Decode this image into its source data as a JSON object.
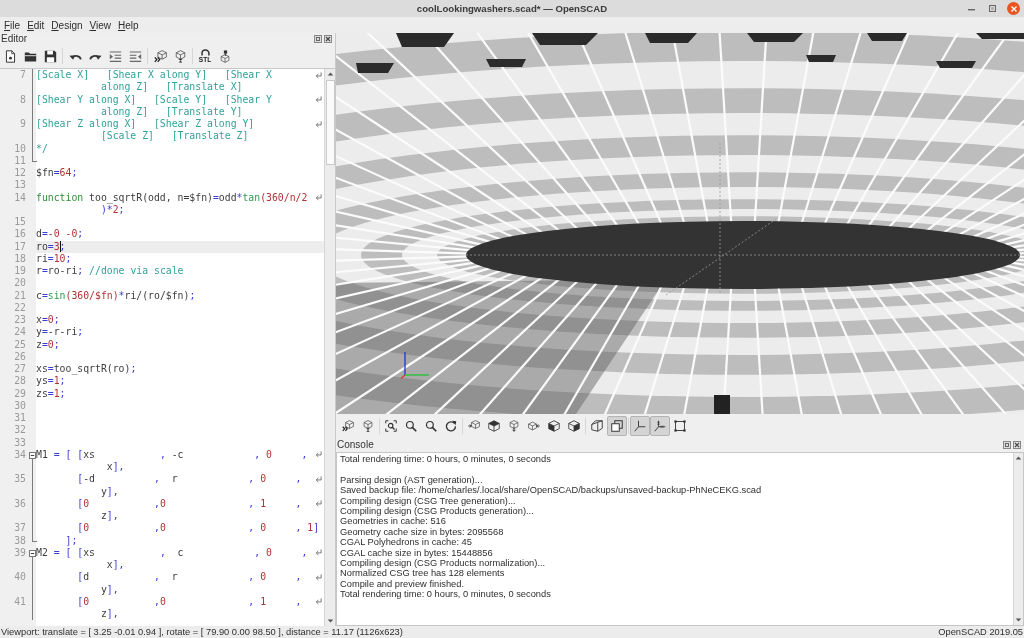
{
  "window": {
    "title": "coolLookingwashers.scad* — OpenSCAD"
  },
  "menu": [
    "File",
    "Edit",
    "Design",
    "View",
    "Help"
  ],
  "editor": {
    "title": "Editor",
    "toolbar": [
      [
        {
          "kind": "new"
        },
        {
          "kind": "open"
        },
        {
          "kind": "save"
        }
      ],
      [
        {
          "kind": "undo"
        },
        {
          "kind": "redo"
        },
        {
          "kind": "indent"
        },
        {
          "kind": "unindent"
        }
      ],
      [
        {
          "kind": "preview"
        },
        {
          "kind": "render"
        }
      ],
      [
        {
          "kind": "export-stl",
          "label": "STL"
        },
        {
          "kind": "print"
        }
      ]
    ],
    "lines": [
      {
        "number": "7",
        "current": false,
        "fold": {
          "kind": "body"
        },
        "visual_lines": [
          {
            "tokens": [
              {
                "kind": "comment",
                "text": "[Scale X]   [Shear X along Y]   [Shear X"
              }
            ]
          },
          {
            "tokens": [
              {
                "kind": "comment",
                "text": "along Z]   [Translate X]"
              }
            ]
          }
        ]
      },
      {
        "number": "8",
        "current": false,
        "fold": {
          "kind": "body"
        },
        "visual_lines": [
          {
            "tokens": [
              {
                "kind": "comment",
                "text": "[Shear Y along X]   [Scale Y]   [Shear Y"
              }
            ]
          },
          {
            "tokens": [
              {
                "kind": "comment",
                "text": "along Z]   [Translate Y]"
              }
            ]
          }
        ]
      },
      {
        "number": "9",
        "current": false,
        "fold": {
          "kind": "body"
        },
        "visual_lines": [
          {
            "tokens": [
              {
                "kind": "comment",
                "text": "[Shear Z along X]   [Shear Z along Y]"
              }
            ]
          },
          {
            "tokens": [
              {
                "kind": "comment",
                "text": "[Scale Z]   [Translate Z]"
              }
            ]
          }
        ]
      },
      {
        "number": "10",
        "current": false,
        "fold": {
          "kind": "body"
        },
        "visual_lines": [
          {
            "tokens": [
              {
                "kind": "comment",
                "text": "*/"
              }
            ]
          }
        ]
      },
      {
        "number": "11",
        "current": false,
        "fold": {
          "kind": "end"
        }
      },
      {
        "number": "12",
        "current": false,
        "visual_lines": [
          {
            "tokens": [
              {
                "kind": "plain",
                "text": "$fn"
              },
              {
                "kind": "op",
                "text": "="
              },
              {
                "kind": "number",
                "text": "64"
              },
              {
                "kind": "op",
                "text": ";"
              }
            ]
          }
        ]
      },
      {
        "number": "13",
        "current": false
      },
      {
        "number": "14",
        "current": false,
        "visual_lines": [
          {
            "tokens": [
              {
                "kind": "keyword",
                "text": "function"
              },
              {
                "kind": "plain",
                "text": " too_sqrtR(odd, n=$fn)"
              },
              {
                "kind": "op",
                "text": "="
              },
              {
                "kind": "plain",
                "text": "odd"
              },
              {
                "kind": "op",
                "text": "*"
              },
              {
                "kind": "builtin",
                "text": "tan"
              },
              {
                "kind": "number",
                "text": "(360/n/2"
              }
            ]
          },
          {
            "tokens": [
              {
                "kind": "op",
                "text": ")*"
              },
              {
                "kind": "number",
                "text": "2"
              },
              {
                "kind": "op",
                "text": ";"
              }
            ]
          }
        ]
      },
      {
        "number": "15",
        "current": false
      },
      {
        "number": "16",
        "current": false,
        "visual_lines": [
          {
            "tokens": [
              {
                "kind": "plain",
                "text": "d"
              },
              {
                "kind": "op",
                "text": "="
              },
              {
                "kind": "number",
                "text": "-0 -0"
              },
              {
                "kind": "op",
                "text": ";"
              }
            ]
          }
        ]
      },
      {
        "number": "17",
        "current": true,
        "visual_lines": [
          {
            "tokens": [
              {
                "kind": "plain",
                "text": "ro"
              },
              {
                "kind": "op",
                "text": "="
              },
              {
                "kind": "number",
                "text": "3"
              },
              {
                "kind": "cursor"
              },
              {
                "kind": "op",
                "text": ";"
              }
            ]
          }
        ]
      },
      {
        "number": "18",
        "current": false,
        "visual_lines": [
          {
            "tokens": [
              {
                "kind": "plain",
                "text": "ri"
              },
              {
                "kind": "op",
                "text": "="
              },
              {
                "kind": "number",
                "text": "10"
              },
              {
                "kind": "op",
                "text": ";"
              }
            ]
          }
        ]
      },
      {
        "number": "19",
        "current": false,
        "visual_lines": [
          {
            "tokens": [
              {
                "kind": "plain",
                "text": "r"
              },
              {
                "kind": "op",
                "text": "="
              },
              {
                "kind": "plain",
                "text": "ro-ri"
              },
              {
                "kind": "op",
                "text": ";"
              },
              {
                "kind": "comment",
                "text": " //done via scale"
              }
            ]
          }
        ]
      },
      {
        "number": "20",
        "current": false
      },
      {
        "number": "21",
        "current": false,
        "visual_lines": [
          {
            "tokens": [
              {
                "kind": "plain",
                "text": "c"
              },
              {
                "kind": "op",
                "text": "="
              },
              {
                "kind": "builtin",
                "text": "sin"
              },
              {
                "kind": "number",
                "text": "(360/$fn)"
              },
              {
                "kind": "op",
                "text": "*"
              },
              {
                "kind": "plain",
                "text": "ri/(ro/$fn)"
              },
              {
                "kind": "op",
                "text": ";"
              }
            ]
          }
        ]
      },
      {
        "number": "22",
        "current": false
      },
      {
        "number": "23",
        "current": false,
        "visual_lines": [
          {
            "tokens": [
              {
                "kind": "plain",
                "text": "x"
              },
              {
                "kind": "op",
                "text": "="
              },
              {
                "kind": "number",
                "text": "0"
              },
              {
                "kind": "op",
                "text": ";"
              }
            ]
          }
        ]
      },
      {
        "number": "24",
        "current": false,
        "visual_lines": [
          {
            "tokens": [
              {
                "kind": "plain",
                "text": "y"
              },
              {
                "kind": "op",
                "text": "="
              },
              {
                "kind": "plain",
                "text": "-r-ri"
              },
              {
                "kind": "op",
                "text": ";"
              }
            ]
          }
        ]
      },
      {
        "number": "25",
        "current": false,
        "visual_lines": [
          {
            "tokens": [
              {
                "kind": "plain",
                "text": "z"
              },
              {
                "kind": "op",
                "text": "="
              },
              {
                "kind": "number",
                "text": "0"
              },
              {
                "kind": "op",
                "text": ";"
              }
            ]
          }
        ]
      },
      {
        "number": "26",
        "current": false
      },
      {
        "number": "27",
        "current": false,
        "visual_lines": [
          {
            "tokens": [
              {
                "kind": "plain",
                "text": "xs"
              },
              {
                "kind": "op",
                "text": "="
              },
              {
                "kind": "plain",
                "text": "too_sqrtR(ro)"
              },
              {
                "kind": "op",
                "text": ";"
              }
            ]
          }
        ]
      },
      {
        "number": "28",
        "current": false,
        "visual_lines": [
          {
            "tokens": [
              {
                "kind": "plain",
                "text": "ys"
              },
              {
                "kind": "op",
                "text": "="
              },
              {
                "kind": "number",
                "text": "1"
              },
              {
                "kind": "op",
                "text": ";"
              }
            ]
          }
        ]
      },
      {
        "number": "29",
        "current": false,
        "visual_lines": [
          {
            "tokens": [
              {
                "kind": "plain",
                "text": "zs"
              },
              {
                "kind": "op",
                "text": "="
              },
              {
                "kind": "number",
                "text": "1"
              },
              {
                "kind": "op",
                "text": ";"
              }
            ]
          }
        ]
      },
      {
        "number": "30",
        "current": false
      },
      {
        "number": "31",
        "current": false
      },
      {
        "number": "32",
        "current": false
      },
      {
        "number": "33",
        "current": false
      },
      {
        "number": "34",
        "current": false,
        "fold": {
          "kind": "start"
        },
        "visual_lines": [
          {
            "tokens": [
              {
                "kind": "plain",
                "text": "M1"
              },
              {
                "kind": "op",
                "text": " = [ ["
              },
              {
                "kind": "plain",
                "text": "xs           "
              },
              {
                "kind": "op",
                "text": ","
              },
              {
                "kind": "plain",
                "text": " -c            "
              },
              {
                "kind": "op",
                "text": ","
              },
              {
                "kind": "number",
                "text": " 0     "
              },
              {
                "kind": "op",
                "text": ","
              }
            ]
          },
          {
            "tokens": [
              {
                "kind": "plain",
                "text": " x"
              },
              {
                "kind": "op",
                "text": "],"
              }
            ]
          }
        ]
      },
      {
        "number": "35",
        "current": false,
        "fold": {
          "kind": "body"
        },
        "visual_lines": [
          {
            "tokens": [
              {
                "kind": "op",
                "text": "       ["
              },
              {
                "kind": "plain",
                "text": "-d          "
              },
              {
                "kind": "op",
                "text": ","
              },
              {
                "kind": "plain",
                "text": "  r            "
              },
              {
                "kind": "op",
                "text": ","
              },
              {
                "kind": "number",
                "text": " 0     "
              },
              {
                "kind": "op",
                "text": ","
              }
            ]
          },
          {
            "tokens": [
              {
                "kind": "plain",
                "text": "y"
              },
              {
                "kind": "op",
                "text": "],"
              }
            ]
          }
        ]
      },
      {
        "number": "36",
        "current": false,
        "fold": {
          "kind": "body"
        },
        "visual_lines": [
          {
            "tokens": [
              {
                "kind": "op",
                "text": "       ["
              },
              {
                "kind": "number",
                "text": "0           "
              },
              {
                "kind": "op",
                "text": ","
              },
              {
                "kind": "number",
                "text": "0              "
              },
              {
                "kind": "op",
                "text": ","
              },
              {
                "kind": "number",
                "text": " 1     "
              },
              {
                "kind": "op",
                "text": ","
              }
            ]
          },
          {
            "tokens": [
              {
                "kind": "plain",
                "text": "z"
              },
              {
                "kind": "op",
                "text": "],"
              }
            ]
          }
        ]
      },
      {
        "number": "37",
        "current": false,
        "fold": {
          "kind": "body"
        },
        "visual_lines": [
          {
            "tokens": [
              {
                "kind": "op",
                "text": "       ["
              },
              {
                "kind": "number",
                "text": "0           "
              },
              {
                "kind": "op",
                "text": ","
              },
              {
                "kind": "number",
                "text": "0              "
              },
              {
                "kind": "op",
                "text": ","
              },
              {
                "kind": "number",
                "text": " 0     "
              },
              {
                "kind": "op",
                "text": ","
              },
              {
                "kind": "number",
                "text": " 1"
              },
              {
                "kind": "op",
                "text": "]"
              }
            ]
          }
        ]
      },
      {
        "number": "38",
        "current": false,
        "fold": {
          "kind": "end"
        },
        "visual_lines": [
          {
            "tokens": [
              {
                "kind": "op",
                "text": "     ];"
              }
            ]
          }
        ]
      },
      {
        "number": "39",
        "current": false,
        "fold": {
          "kind": "start"
        },
        "visual_lines": [
          {
            "tokens": [
              {
                "kind": "plain",
                "text": "M2"
              },
              {
                "kind": "op",
                "text": " = [ ["
              },
              {
                "kind": "plain",
                "text": "xs           "
              },
              {
                "kind": "op",
                "text": ","
              },
              {
                "kind": "plain",
                "text": "  c            "
              },
              {
                "kind": "op",
                "text": ","
              },
              {
                "kind": "number",
                "text": " 0     "
              },
              {
                "kind": "op",
                "text": ","
              }
            ]
          },
          {
            "tokens": [
              {
                "kind": "plain",
                "text": " x"
              },
              {
                "kind": "op",
                "text": "],"
              }
            ]
          }
        ]
      },
      {
        "number": "40",
        "current": false,
        "fold": {
          "kind": "body"
        },
        "visual_lines": [
          {
            "tokens": [
              {
                "kind": "op",
                "text": "       ["
              },
              {
                "kind": "plain",
                "text": "d           "
              },
              {
                "kind": "op",
                "text": ","
              },
              {
                "kind": "plain",
                "text": "  r            "
              },
              {
                "kind": "op",
                "text": ","
              },
              {
                "kind": "number",
                "text": " 0     "
              },
              {
                "kind": "op",
                "text": ","
              }
            ]
          },
          {
            "tokens": [
              {
                "kind": "plain",
                "text": "y"
              },
              {
                "kind": "op",
                "text": "],"
              }
            ]
          }
        ]
      },
      {
        "number": "41",
        "current": false,
        "fold": {
          "kind": "body"
        },
        "visual_lines": [
          {
            "tokens": [
              {
                "kind": "op",
                "text": "       ["
              },
              {
                "kind": "number",
                "text": "0           "
              },
              {
                "kind": "op",
                "text": ","
              },
              {
                "kind": "number",
                "text": "0              "
              },
              {
                "kind": "op",
                "text": ","
              },
              {
                "kind": "number",
                "text": " 1     "
              },
              {
                "kind": "op",
                "text": ","
              }
            ]
          },
          {
            "tokens": [
              {
                "kind": "plain",
                "text": "z"
              },
              {
                "kind": "op",
                "text": "],"
              }
            ]
          }
        ]
      }
    ]
  },
  "viewport": {
    "toolbar": [
      [
        {
          "kind": "preview",
          "pressed": false
        },
        {
          "kind": "render",
          "pressed": false
        }
      ],
      [
        {
          "kind": "view-all",
          "pressed": false
        },
        {
          "kind": "zoom-in",
          "pressed": false
        },
        {
          "kind": "zoom-out",
          "pressed": false
        },
        {
          "kind": "reset",
          "pressed": false
        }
      ],
      [
        {
          "kind": "view-right",
          "pressed": false
        },
        {
          "kind": "view-top",
          "pressed": false
        },
        {
          "kind": "view-bottom",
          "pressed": false
        },
        {
          "kind": "view-left",
          "pressed": false
        },
        {
          "kind": "view-front",
          "pressed": false
        },
        {
          "kind": "view-back",
          "pressed": false
        }
      ],
      [
        {
          "kind": "perspective",
          "pressed": false
        },
        {
          "kind": "orthogonal",
          "pressed": true
        }
      ],
      [
        {
          "kind": "axes",
          "pressed": true
        },
        {
          "kind": "scale-markers",
          "pressed": true
        },
        {
          "kind": "edges",
          "pressed": false
        }
      ]
    ]
  },
  "console": {
    "title": "Console",
    "groups": [
      [
        "Total rendering time: 0 hours, 0 minutes, 0 seconds"
      ],
      [
        "Parsing design (AST generation)...",
        "Saved backup file: /home/charles/.local/share/OpenSCAD/backups/unsaved-backup-PhNeCEKG.scad",
        "Compiling design (CSG Tree generation)...",
        "Compiling design (CSG Products generation)...",
        "Geometries in cache: 516",
        "Geometry cache size in bytes: 2095568",
        "CGAL Polyhedrons in cache: 45",
        "CGAL cache size in bytes: 15448856",
        "Compiling design (CSG Products normalization)...",
        "Normalized CSG tree has 128 elements",
        "Compile and preview finished.",
        "Total rendering time: 0 hours, 0 minutes, 0 seconds"
      ]
    ]
  },
  "status_bar": {
    "left": "Viewport: translate = [ 3.25 -0.01 0.94 ], rotate = [ 79.90 0.00 98.50 ], distance = 11.17 (1126x623)",
    "right": "OpenSCAD 2019.05"
  }
}
